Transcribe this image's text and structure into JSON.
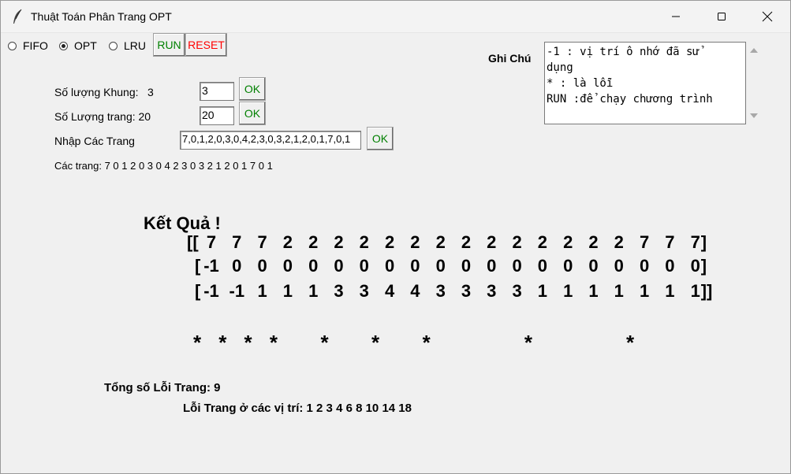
{
  "window": {
    "title": "Thuật Toán Phân Trang OPT"
  },
  "controls": {
    "algorithms": [
      {
        "label": "FIFO",
        "selected": false
      },
      {
        "label": "OPT",
        "selected": true
      },
      {
        "label": "LRU",
        "selected": false
      }
    ],
    "run_label": "RUN",
    "reset_label": "RESET",
    "run_color": "#008000",
    "reset_color": "#ff0000"
  },
  "notes": {
    "label": "Ghi Chú",
    "lines": [
      "-1 : vị trí ô nhớ đã sử",
      "dụng",
      "* : là lỗi",
      "RUN :để chạy chương trình"
    ]
  },
  "form": {
    "frames_label": "Số lượng Khung:",
    "frames_value_text": "3",
    "frames_input": "3",
    "pages_label": "Số Lượng trang: 20",
    "pages_input": "20",
    "pages_sequence_label": "Nhập Các Trang",
    "pages_sequence_input": "7,0,1,2,0,3,0,4,2,3,0,3,2,1,2,0,1,7,0,1",
    "ok_label": "OK",
    "pages_display": "Các trang: 7 0 1 2 0 3 0 4 2 3 0 3 2 1 2 0 1 7 0 1"
  },
  "result": {
    "heading": "Kết Quả !",
    "matrix": [
      [
        "7",
        "7",
        "7",
        "2",
        "2",
        "2",
        "2",
        "2",
        "2",
        "2",
        "2",
        "2",
        "2",
        "2",
        "2",
        "2",
        "2",
        "7",
        "7",
        "7"
      ],
      [
        "-1",
        "0",
        "0",
        "0",
        "0",
        "0",
        "0",
        "0",
        "0",
        "0",
        "0",
        "0",
        "0",
        "0",
        "0",
        "0",
        "0",
        "0",
        "0",
        "0"
      ],
      [
        "-1",
        "-1",
        "1",
        "1",
        "1",
        "3",
        "3",
        "4",
        "4",
        "3",
        "3",
        "3",
        "3",
        "1",
        "1",
        "1",
        "1",
        "1",
        "1",
        "1"
      ]
    ],
    "bracket_open_first": "[[",
    "bracket_open": "[",
    "bracket_close": "]",
    "bracket_close_last": "]]",
    "fault_positions": [
      1,
      2,
      3,
      4,
      6,
      8,
      10,
      14,
      18
    ],
    "fault_marker": "*",
    "total_faults": "Tổng số Lỗi Trang: 9",
    "fault_list": "Lỗi Trang ở các vị trí: 1 2 3 4 6 8 10 14 18"
  }
}
